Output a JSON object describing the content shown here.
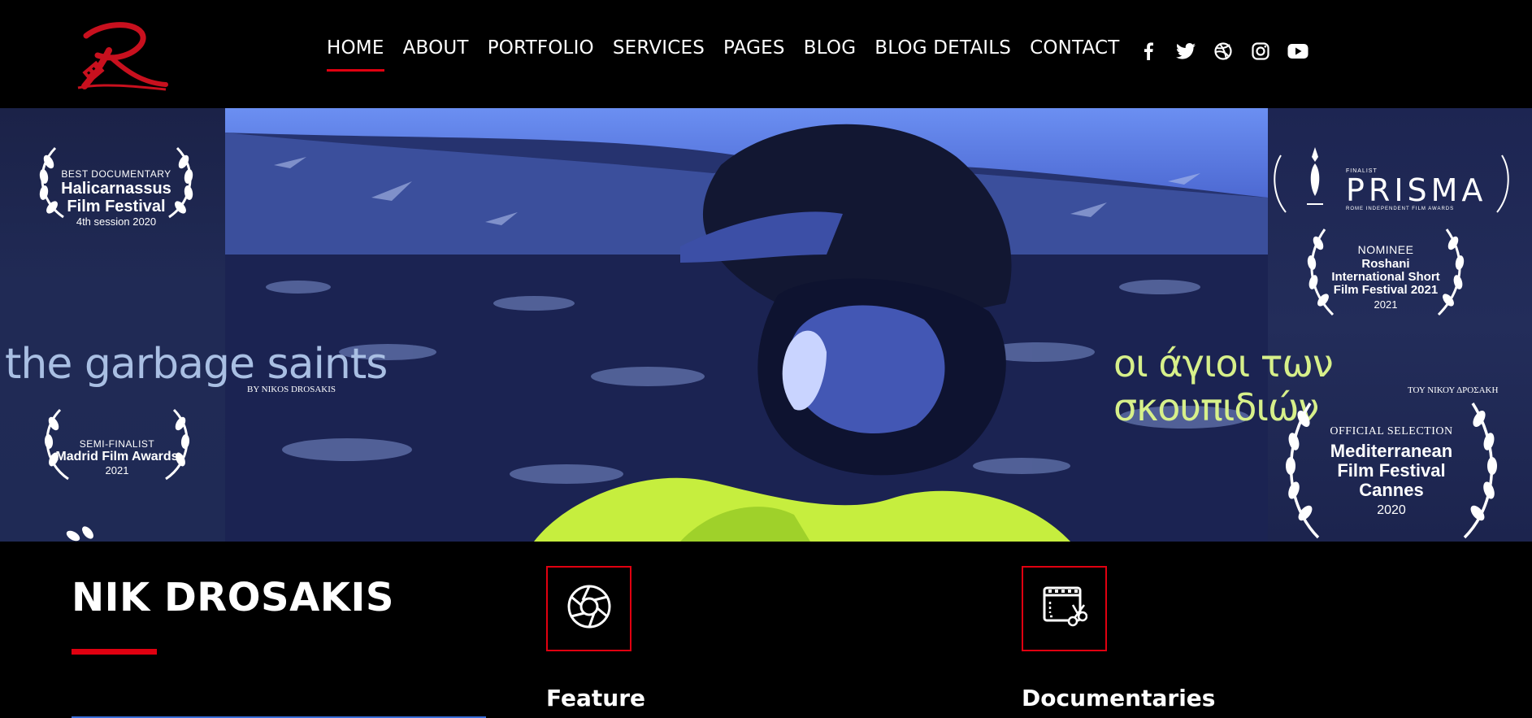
{
  "nav": {
    "items": [
      "HOME",
      "ABOUT",
      "PORTFOLIO",
      "SERVICES",
      "PAGES",
      "BLOG",
      "BLOG DETAILS",
      "CONTACT"
    ],
    "active": "HOME"
  },
  "social": [
    "facebook-icon",
    "twitter-icon",
    "dribbble-icon",
    "instagram-icon",
    "youtube-icon"
  ],
  "hero": {
    "awards_left": [
      {
        "small": "BEST DOCUMENTARY",
        "big": "Halicarnassus Film Festival",
        "sub": "4th session 2020"
      },
      {
        "small": "SEMI-FINALIST",
        "big": "Madrid Film Awards",
        "sub": "2021"
      }
    ],
    "title_en": "the garbage saints",
    "title_en_by": "BY NIKOS DROSAKIS",
    "title_gr": "οι άγιοι των σκουπιδιών",
    "title_gr_by": "ΤΟΥ ΝΙΚΟΥ ΔΡΟΣΑΚΗ",
    "prisma": {
      "finalist": "FINALIST",
      "name": "PRISMA",
      "sub": "ROME INDEPENDENT FILM AWARDS"
    },
    "awards_right": [
      {
        "small": "NOMINEE",
        "big": "Roshani International Short Film Festival 2021",
        "sub": "2021"
      },
      {
        "small": "OFFICIAL SELECTION",
        "big": "Mediterranean Film Festival Cannes",
        "sub": "2020"
      }
    ]
  },
  "bottom": {
    "name": "NIK DROSAKIS",
    "services": [
      {
        "icon": "camera-aperture-icon",
        "title": "Feature"
      },
      {
        "icon": "film-edit-icon",
        "title": "Documentaries"
      }
    ]
  },
  "colors": {
    "accent": "#e00010",
    "background": "#000000"
  }
}
